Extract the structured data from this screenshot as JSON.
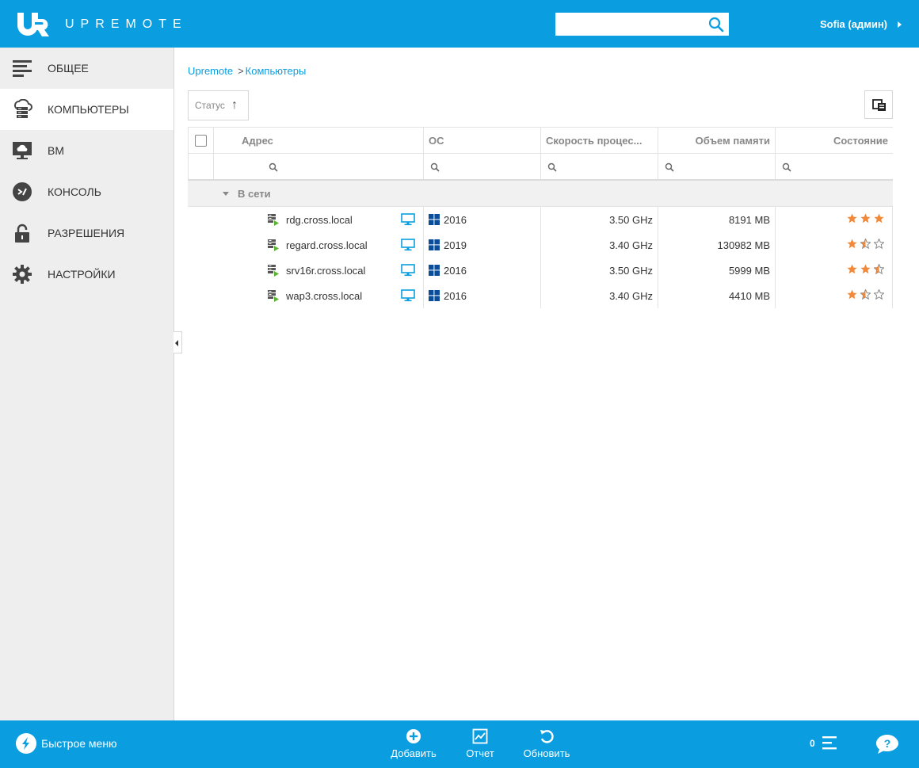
{
  "header": {
    "logo_text": "UPREMOTE",
    "search_placeholder": "",
    "user": "Sofia (админ)"
  },
  "sidebar": {
    "items": [
      {
        "label": "ОБЩЕЕ",
        "icon": "list-icon"
      },
      {
        "label": "КОМПЬЮТЕРЫ",
        "icon": "server-cloud-icon",
        "active": true
      },
      {
        "label": "ВМ",
        "icon": "vm-monitor-icon"
      },
      {
        "label": "КОНСОЛЬ",
        "icon": "console-icon"
      },
      {
        "label": "РАЗРЕШЕНИЯ",
        "icon": "lock-icon"
      },
      {
        "label": "НАСТРОЙКИ",
        "icon": "gear-icon"
      }
    ]
  },
  "breadcrumb": {
    "root": "Upremote",
    "separator": ">",
    "current": "Компьютеры"
  },
  "toolbar": {
    "sort_label": "Статус",
    "sort_arrow": "↑"
  },
  "grid": {
    "columns": [
      "Адрес",
      "ОС",
      "Скорость процес...",
      "Объем памяти",
      "Состояние"
    ],
    "group_label": "В сети",
    "rows": [
      {
        "address": "rdg.cross.local",
        "os": "2016",
        "cpu": "3.50 GHz",
        "memory": "8191 MB",
        "rating": 3.0
      },
      {
        "address": "regard.cross.local",
        "os": "2019",
        "cpu": "3.40 GHz",
        "memory": "130982 MB",
        "rating": 1.5
      },
      {
        "address": "srv16r.cross.local",
        "os": "2016",
        "cpu": "3.50 GHz",
        "memory": "5999 MB",
        "rating": 2.5
      },
      {
        "address": "wap3.cross.local",
        "os": "2016",
        "cpu": "3.40 GHz",
        "memory": "4410 MB",
        "rating": 1.5
      }
    ]
  },
  "bottombar": {
    "quick_menu": "Быстрое меню",
    "add": "Добавить",
    "report": "Отчет",
    "refresh": "Обновить",
    "count": "0"
  },
  "colors": {
    "primary": "#0a9ee0",
    "star": "#f0893a",
    "online_arrow": "#5cb531",
    "windows_blue": "#0a4d9b"
  }
}
